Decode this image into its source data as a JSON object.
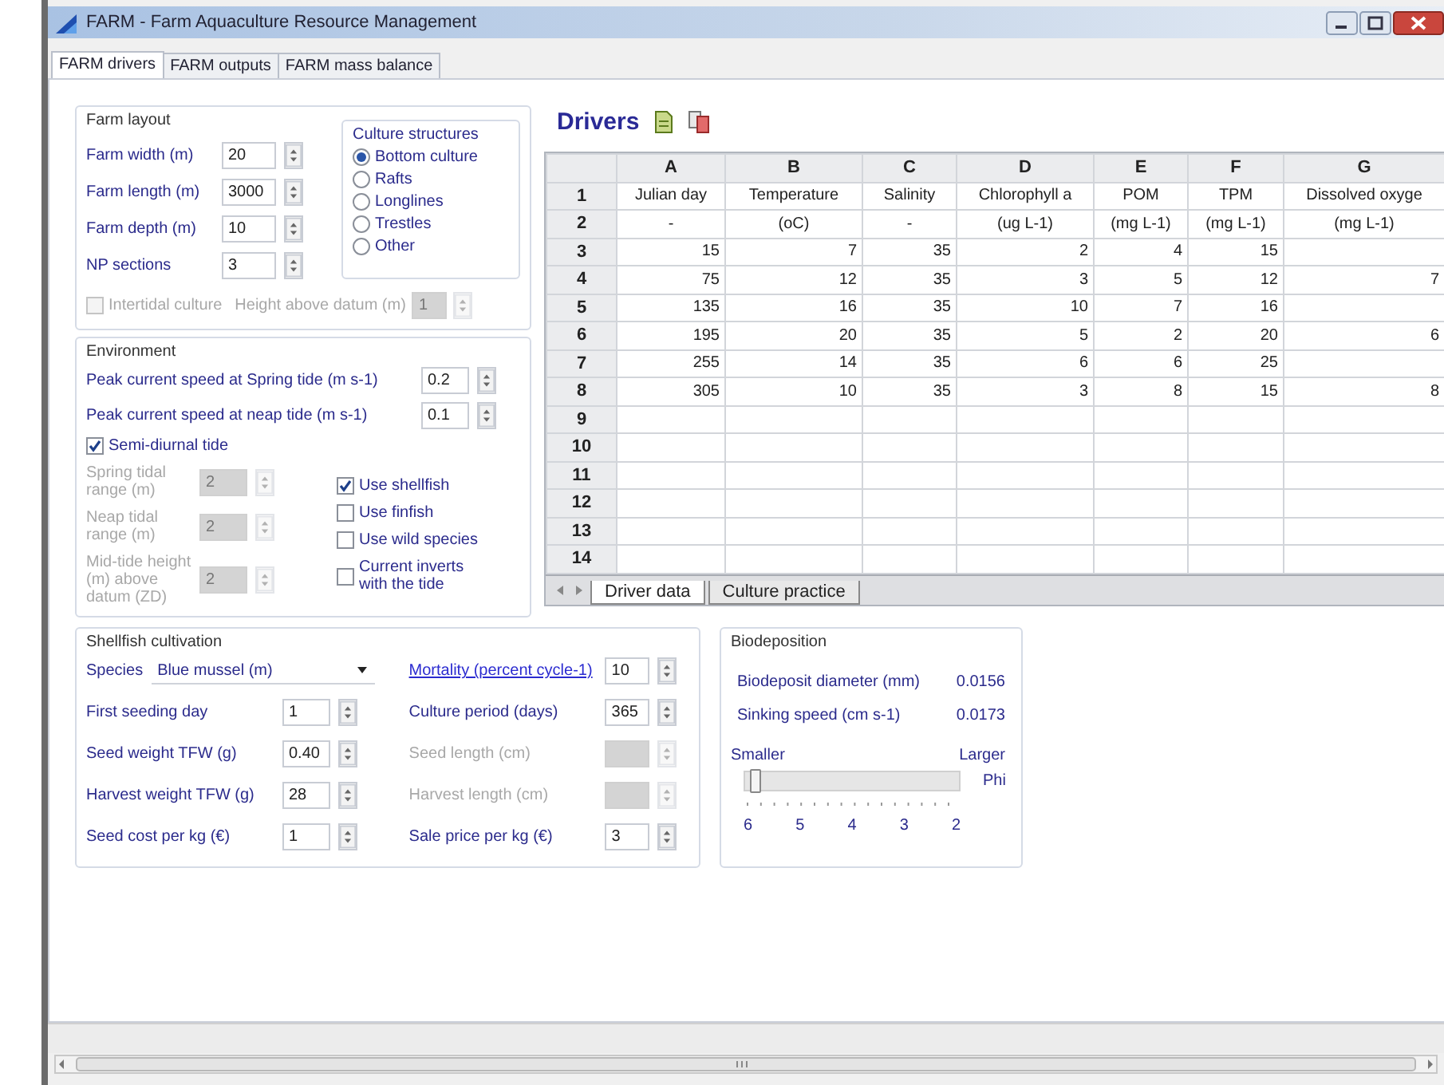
{
  "window": {
    "title": "FARM - Farm Aquaculture Resource Management"
  },
  "tabs": [
    {
      "label": "FARM drivers",
      "selected": true
    },
    {
      "label": "FARM outputs",
      "selected": false
    },
    {
      "label": "FARM mass balance",
      "selected": false
    }
  ],
  "farm_layout": {
    "title": "Farm layout",
    "fields": [
      {
        "label": "Farm width (m)",
        "value": "20"
      },
      {
        "label": "Farm length (m)",
        "value": "3000"
      },
      {
        "label": "Farm depth (m)",
        "value": "10"
      },
      {
        "label": "NP sections",
        "value": "3"
      }
    ],
    "culture_structures": {
      "title": "Culture structures",
      "options": [
        {
          "label": "Bottom culture",
          "selected": true
        },
        {
          "label": "Rafts",
          "selected": false
        },
        {
          "label": "Longlines",
          "selected": false
        },
        {
          "label": "Trestles",
          "selected": false
        },
        {
          "label": "Other",
          "selected": false
        }
      ]
    },
    "intertidal": {
      "label": "Intertidal culture",
      "checked": false,
      "disabled": true
    },
    "height_above_datum": {
      "label": "Height above datum (m)",
      "value": "1",
      "disabled": true
    }
  },
  "environment": {
    "title": "Environment",
    "currents": [
      {
        "label": "Peak current speed at Spring tide (m s-1)",
        "value": "0.2"
      },
      {
        "label": "Peak current speed at neap tide (m s-1)",
        "value": "0.1"
      }
    ],
    "semi_diurnal": {
      "label": "Semi-diurnal tide",
      "checked": true
    },
    "tide_fields": [
      {
        "label": "Spring tidal range (m)",
        "value": "2",
        "disabled": true
      },
      {
        "label": "Neap tidal range (m)",
        "value": "2",
        "disabled": true
      },
      {
        "label": "Mid-tide height (m) above datum (ZD)",
        "value": "2",
        "disabled": true
      }
    ],
    "options": [
      {
        "label": "Use shellfish",
        "checked": true
      },
      {
        "label": "Use finfish",
        "checked": false
      },
      {
        "label": "Use wild species",
        "checked": false
      },
      {
        "label": "Current inverts with the tide",
        "checked": false
      }
    ]
  },
  "drivers": {
    "title": "Drivers",
    "columns": [
      "A",
      "B",
      "C",
      "D",
      "E",
      "F",
      "G"
    ],
    "rows": [
      {
        "number": "1",
        "kind": "label",
        "cells": [
          "Julian day",
          "Temperature",
          "Salinity",
          "Chlorophyll a",
          "POM",
          "TPM",
          "Dissolved oxyge"
        ]
      },
      {
        "number": "2",
        "kind": "label",
        "cells": [
          "-",
          "(oC)",
          "-",
          "(ug L-1)",
          "(mg L-1)",
          "(mg L-1)",
          "(mg L-1)"
        ]
      },
      {
        "number": "3",
        "kind": "number",
        "cells": [
          "15",
          "7",
          "35",
          "2",
          "4",
          "15",
          null
        ]
      },
      {
        "number": "4",
        "kind": "number",
        "cells": [
          "75",
          "12",
          "35",
          "3",
          "5",
          "12",
          "7"
        ]
      },
      {
        "number": "5",
        "kind": "number",
        "cells": [
          "135",
          "16",
          "35",
          "10",
          "7",
          "16",
          null
        ]
      },
      {
        "number": "6",
        "kind": "number",
        "cells": [
          "195",
          "20",
          "35",
          "5",
          "2",
          "20",
          "6"
        ]
      },
      {
        "number": "7",
        "kind": "number",
        "cells": [
          "255",
          "14",
          "35",
          "6",
          "6",
          "25",
          null
        ]
      },
      {
        "number": "8",
        "kind": "number",
        "cells": [
          "305",
          "10",
          "35",
          "3",
          "8",
          "15",
          "8"
        ]
      },
      {
        "number": "9",
        "kind": "empty"
      },
      {
        "number": "10",
        "kind": "empty"
      },
      {
        "number": "11",
        "kind": "empty"
      },
      {
        "number": "12",
        "kind": "empty"
      },
      {
        "number": "13",
        "kind": "empty"
      },
      {
        "number": "14",
        "kind": "empty"
      }
    ],
    "sheet_tabs": [
      {
        "label": "Driver data",
        "selected": true
      },
      {
        "label": "Culture practice",
        "selected": false
      }
    ]
  },
  "shellfish": {
    "title": "Shellfish cultivation",
    "species": {
      "label": "Species",
      "value": "Blue mussel (m)"
    },
    "mortality": {
      "label": "Mortality (percent cycle-1)",
      "value": "10"
    },
    "rows": [
      {
        "left": {
          "label": "First seeding day",
          "value": "1"
        },
        "right": {
          "label": "Culture period (days)",
          "value": "365"
        }
      },
      {
        "left": {
          "label": "Seed weight TFW (g)",
          "value": "0.40"
        },
        "right": {
          "label": "Seed length (cm)",
          "disabled": true
        }
      },
      {
        "left": {
          "label": "Harvest weight TFW (g)",
          "value": "28"
        },
        "right": {
          "label": "Harvest length (cm)",
          "disabled": true
        }
      },
      {
        "left": {
          "label": "Seed cost per kg (€)",
          "value": "1"
        },
        "right": {
          "label": "Sale price per kg (€)",
          "value": "3"
        }
      }
    ]
  },
  "biodeposition": {
    "title": "Biodeposition",
    "readings": [
      {
        "label": "Biodeposit diameter (mm)",
        "value": "0.0156"
      },
      {
        "label": "Sinking speed (cm s-1)",
        "value": "0.0173"
      }
    ],
    "slider": {
      "left_label": "Smaller",
      "right_label": "Larger",
      "unit": "Phi",
      "level": 0.02,
      "ticks": [
        "6",
        "5",
        "4",
        "3",
        "2"
      ]
    }
  }
}
